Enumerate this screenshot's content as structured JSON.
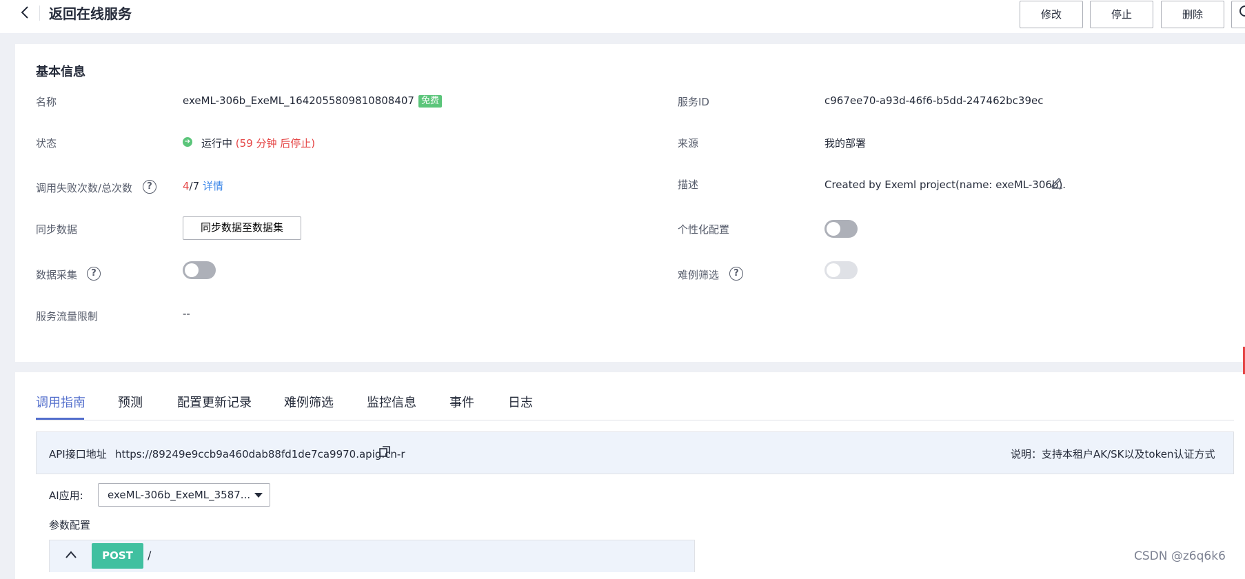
{
  "header": {
    "title": "返回在线服务",
    "buttons": {
      "edit": "修改",
      "stop": "停止",
      "delete": "删除"
    }
  },
  "basic": {
    "section_title": "基本信息",
    "name_label": "名称",
    "name_value": "exeML-306b_ExeML_1642055809810808407",
    "free_tag": "免费",
    "service_id_label": "服务ID",
    "service_id_value": "c967ee70-a93d-46f6-b5dd-247462bc39ec",
    "status_label": "状态",
    "status_value": "运行中",
    "status_remaining": "(59 分钟 后停止)",
    "source_label": "来源",
    "source_value": "我的部署",
    "calls_label": "调用失败次数/总次数",
    "calls_failed": "4",
    "calls_total": "/7",
    "calls_detail_link": "详情",
    "desc_label": "描述",
    "desc_value": "Created by Exeml project(name: exeML-306b).",
    "sync_label": "同步数据",
    "sync_button": "同步数据至数据集",
    "personal_config_label": "个性化配置",
    "personal_config_on": false,
    "collect_label": "数据采集",
    "collect_on": false,
    "hard_example_label": "难例筛选",
    "hard_example_on": false,
    "flow_limit_label": "服务流量限制",
    "flow_limit_value": "--"
  },
  "tabs": [
    "调用指南",
    "预测",
    "配置更新记录",
    "难例筛选",
    "监控信息",
    "事件",
    "日志"
  ],
  "api": {
    "label": "API接口地址",
    "url": "https://89249e9ccb9a460dab88fd1de7ca9970.apig.cn-r",
    "note": "说明：支持本租户AK/SK以及token认证方式"
  },
  "ai_app": {
    "label": "AI应用:",
    "selected": "exeML-306b_ExeML_3587..."
  },
  "params": {
    "label": "参数配置",
    "method": "POST",
    "path": "/"
  },
  "watermark": "CSDN @z6q6k6",
  "colors": {
    "accent": "#526ecc",
    "success": "#5bc57a",
    "danger": "#e54545",
    "link": "#3a86e8"
  }
}
